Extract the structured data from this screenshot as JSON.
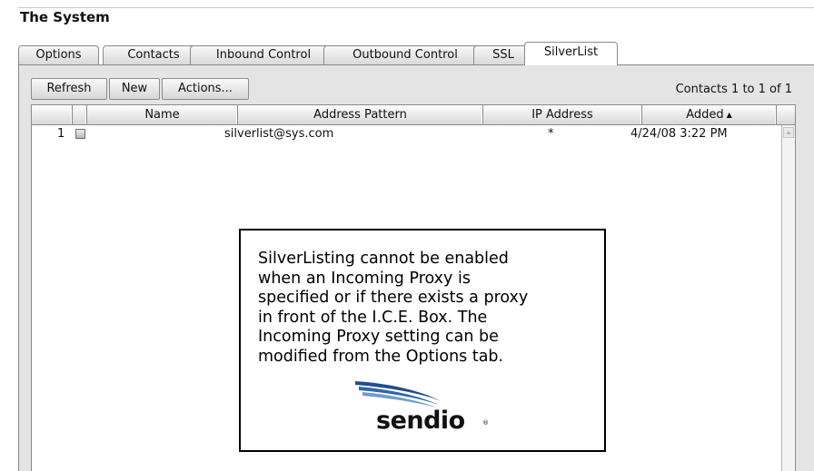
{
  "page": {
    "title": "The System"
  },
  "tabs": [
    {
      "label": "Options"
    },
    {
      "label": "Contacts"
    },
    {
      "label": "Inbound Control"
    },
    {
      "label": "Outbound Control"
    },
    {
      "label": "SSL"
    },
    {
      "label": "SilverList",
      "active": true
    }
  ],
  "toolbar": {
    "refresh_label": "Refresh",
    "new_label": "New",
    "actions_label": "Actions...",
    "count_text": "Contacts 1 to 1 of 1"
  },
  "grid": {
    "columns": [
      "",
      "Name",
      "Address Pattern",
      "IP Address",
      "Added"
    ],
    "sort_indicator": "▲",
    "rows": [
      {
        "number": "1",
        "name": "",
        "address_pattern": "silverlist@sys.com",
        "ip_address": "*",
        "added": "4/24/08 3:22 PM"
      }
    ]
  },
  "callout": {
    "lines": [
      "SilverListing cannot be enabled",
      "when an Incoming Proxy is",
      "specified or if there exists a proxy",
      "in front of the I.C.E. Box. The",
      "Incoming Proxy setting can be",
      "modified from the Options tab."
    ],
    "logo_text": "sendio",
    "logo_mark": "®"
  },
  "colors": {
    "logo_blue": "#1f4f8f",
    "logo_blue_light": "#6f9bd0",
    "panel_bg": "#e4e4e4"
  }
}
